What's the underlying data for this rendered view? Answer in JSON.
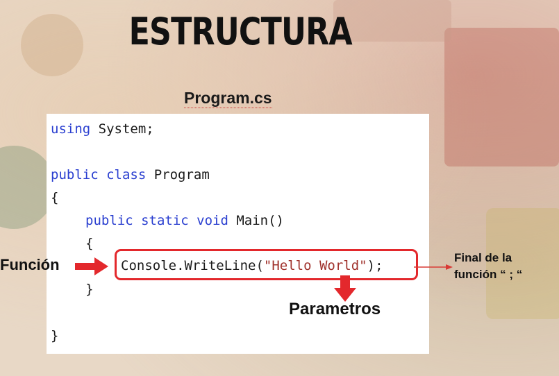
{
  "title": "ESTRUCTURA",
  "file_name": "Program.cs",
  "code": {
    "line1_kw": "using",
    "line1_rest": " System;",
    "line2_kw": "public class",
    "line2_rest": " Program",
    "line3": "{",
    "line4_kw": "public static void",
    "line4_rest": " Main()",
    "line5": "{",
    "line6_pre": "Console.WriteLine(",
    "line6_str": "\"Hello World\"",
    "line6_post": ");",
    "line7": "}",
    "line8": "}"
  },
  "annotations": {
    "funcion": "Función",
    "parametros": "Parametros",
    "final_line1": "Final de la",
    "final_line2": "función “ ; “"
  },
  "colors": {
    "keyword": "#2a3fd0",
    "string": "#a0322c",
    "highlight": "#e3282c"
  }
}
